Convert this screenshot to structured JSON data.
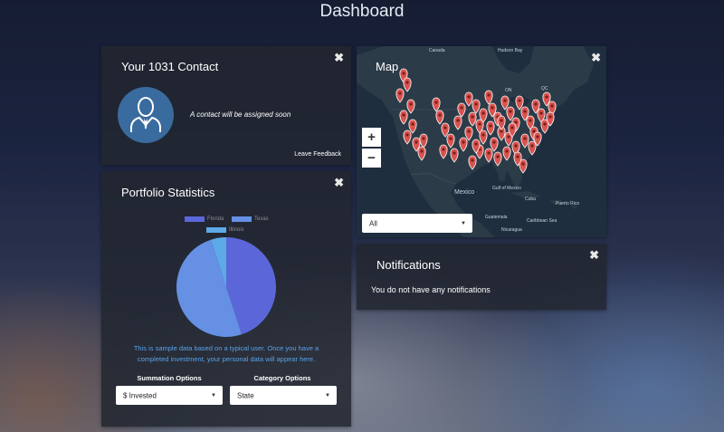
{
  "page": {
    "title": "Dashboard"
  },
  "contact": {
    "title": "Your 1031 Contact",
    "message": "A contact will be assigned soon",
    "feedback_link": "Leave Feedback",
    "close_icon": "✖",
    "avatar_icon": "user-tie-icon"
  },
  "portfolio": {
    "title": "Portfolio Statistics",
    "close_icon": "✖",
    "note": "This is sample data based on a typical user. Once you have a completed investment, your personal data will appear here.",
    "summation": {
      "label": "Summation Options",
      "selected": "$ Invested"
    },
    "category": {
      "label": "Category Options",
      "selected": "State"
    },
    "caret": "▼",
    "chart_data": {
      "type": "pie",
      "categories": [
        "Florida",
        "Texas",
        "Illinois"
      ],
      "values": [
        45,
        50,
        5
      ],
      "colors": [
        "#5b67d8",
        "#6590e4",
        "#5ea9e8"
      ],
      "legend_position": "top"
    }
  },
  "map": {
    "title": "Map",
    "close_icon": "✖",
    "zoom_in": "+",
    "zoom_out": "−",
    "filter_selected": "All",
    "caret": "▼",
    "marker_color": "#d9534f",
    "labels": {
      "canada": "Canada",
      "hudson_bay": "Hudson Bay",
      "on": "ON",
      "qc": "QC",
      "mexico": "Mexico",
      "gulf": "Gulf of Mexico",
      "cuba": "Cuba",
      "puerto_rico": "Puerto Rico",
      "guatemala": "Guatemala",
      "caribbean": "Caribbean Sea",
      "nicaragua": "Nicaragua"
    }
  },
  "notifications": {
    "title": "Notifications",
    "close_icon": "✖",
    "empty_message": "You do not have any notifications"
  }
}
